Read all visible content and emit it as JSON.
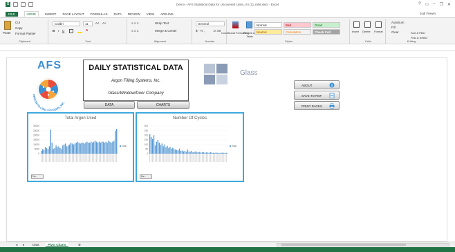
{
  "window": {
    "title": "Demo - AFS Statistical Data for Uncovered Units_V4 (1)_inlet.xlsm - Excel",
    "user": "Jodi Frewin"
  },
  "tabs": [
    "FILE",
    "HOME",
    "INSERT",
    "PAGE LAYOUT",
    "FORMULAS",
    "DATA",
    "REVIEW",
    "VIEW",
    "ADD-INS"
  ],
  "ribbon": {
    "clipboard": {
      "cut": "Cut",
      "copy": "Copy",
      "paste": "Paste",
      "format_painter": "Format Painter",
      "label": "Clipboard"
    },
    "font": {
      "name": "Calibri",
      "size": "11",
      "label": "Font"
    },
    "alignment": {
      "wrap": "Wrap Text",
      "merge": "Merge & Center",
      "label": "Alignment"
    },
    "number": {
      "format": "General",
      "label": "Number"
    },
    "styles": {
      "conditional": "Conditional Formatting",
      "format_table": "Format as Table",
      "normal": "Normal",
      "bad": "Bad",
      "good": "Good",
      "neutral": "Neutral",
      "calculation": "Calculation",
      "check_cell": "Check Cell",
      "label": "Styles"
    },
    "cells": {
      "insert": "Insert",
      "delete": "Delete",
      "format": "Format",
      "label": "Cells"
    },
    "editing": {
      "autosum": "AutoSum",
      "fill": "Fill",
      "clear": "Clear",
      "sort": "Sort & Filter",
      "find": "Find & Select",
      "label": "Editing"
    }
  },
  "dashboard": {
    "logo_text": "AFS",
    "logo_ring_text": "ARGON FILLING SYSTEMS, INC.",
    "title": "DAILY STATISTICAL DATA",
    "company": "Argon Filling Systems, Inc.",
    "subtitle": "Glass/Window/Door Company",
    "data_button": "DATA",
    "charts_button": "CHARTS",
    "glass_logo_text": "Glass",
    "about_button": "ABOUT",
    "save_pdf_button": "SAVE TO PDF",
    "print_button": "PRINT PAGES"
  },
  "chart_data": [
    {
      "type": "bar",
      "title": "Total Argon Used",
      "legend": [
        "Total"
      ],
      "legend_position": "right",
      "ylim": [
        0,
        30000
      ],
      "yticks": [
        "30000",
        "25000",
        "20000",
        "15000",
        "10000",
        "5000",
        "0"
      ],
      "values": [
        3000,
        5000,
        4000,
        7000,
        6000,
        5000,
        8000,
        26000,
        12000,
        5000,
        6000,
        9000,
        7000,
        8000,
        6000,
        5000,
        9000,
        10000,
        11000,
        8000,
        9000,
        10000,
        12000,
        11000,
        10000,
        11000,
        12000,
        13000,
        12000,
        11000,
        12000,
        12000,
        11000,
        12000,
        13000,
        12000,
        12000,
        13000,
        12000,
        13000,
        14000,
        13000,
        12000,
        13000,
        12000,
        13000,
        13000,
        12000,
        13000,
        12000,
        14000,
        13000,
        12000,
        13000,
        14000,
        25000,
        27000
      ]
    },
    {
      "type": "bar",
      "title": "Number Of Cycles",
      "legend": [
        "Total"
      ],
      "legend_position": "right",
      "ylim": [
        0,
        300
      ],
      "yticks": [
        "300",
        "250",
        "200",
        "150",
        "100",
        "50",
        "0"
      ],
      "values": [
        210,
        180,
        160,
        200,
        90,
        130,
        150,
        120,
        95,
        110,
        80,
        100,
        70,
        85,
        60,
        75,
        55,
        65,
        50,
        45,
        40,
        35,
        55,
        30,
        35,
        25,
        30,
        20,
        45,
        25,
        20,
        30,
        15,
        20,
        25,
        18,
        15,
        20,
        12,
        18,
        15,
        10,
        14,
        12,
        10,
        15,
        12,
        10,
        8,
        12,
        10,
        9,
        8,
        10,
        12,
        9,
        8,
        10
      ]
    }
  ],
  "filters": [
    "Da..."
  ],
  "sheet_tabs": [
    "Data",
    "Pivot Charts"
  ],
  "colors": {
    "excel_green": "#217346",
    "chart_border": "#3da9dc",
    "bar": "#5b9bd5",
    "afs_blue": "#3b8fd4"
  }
}
